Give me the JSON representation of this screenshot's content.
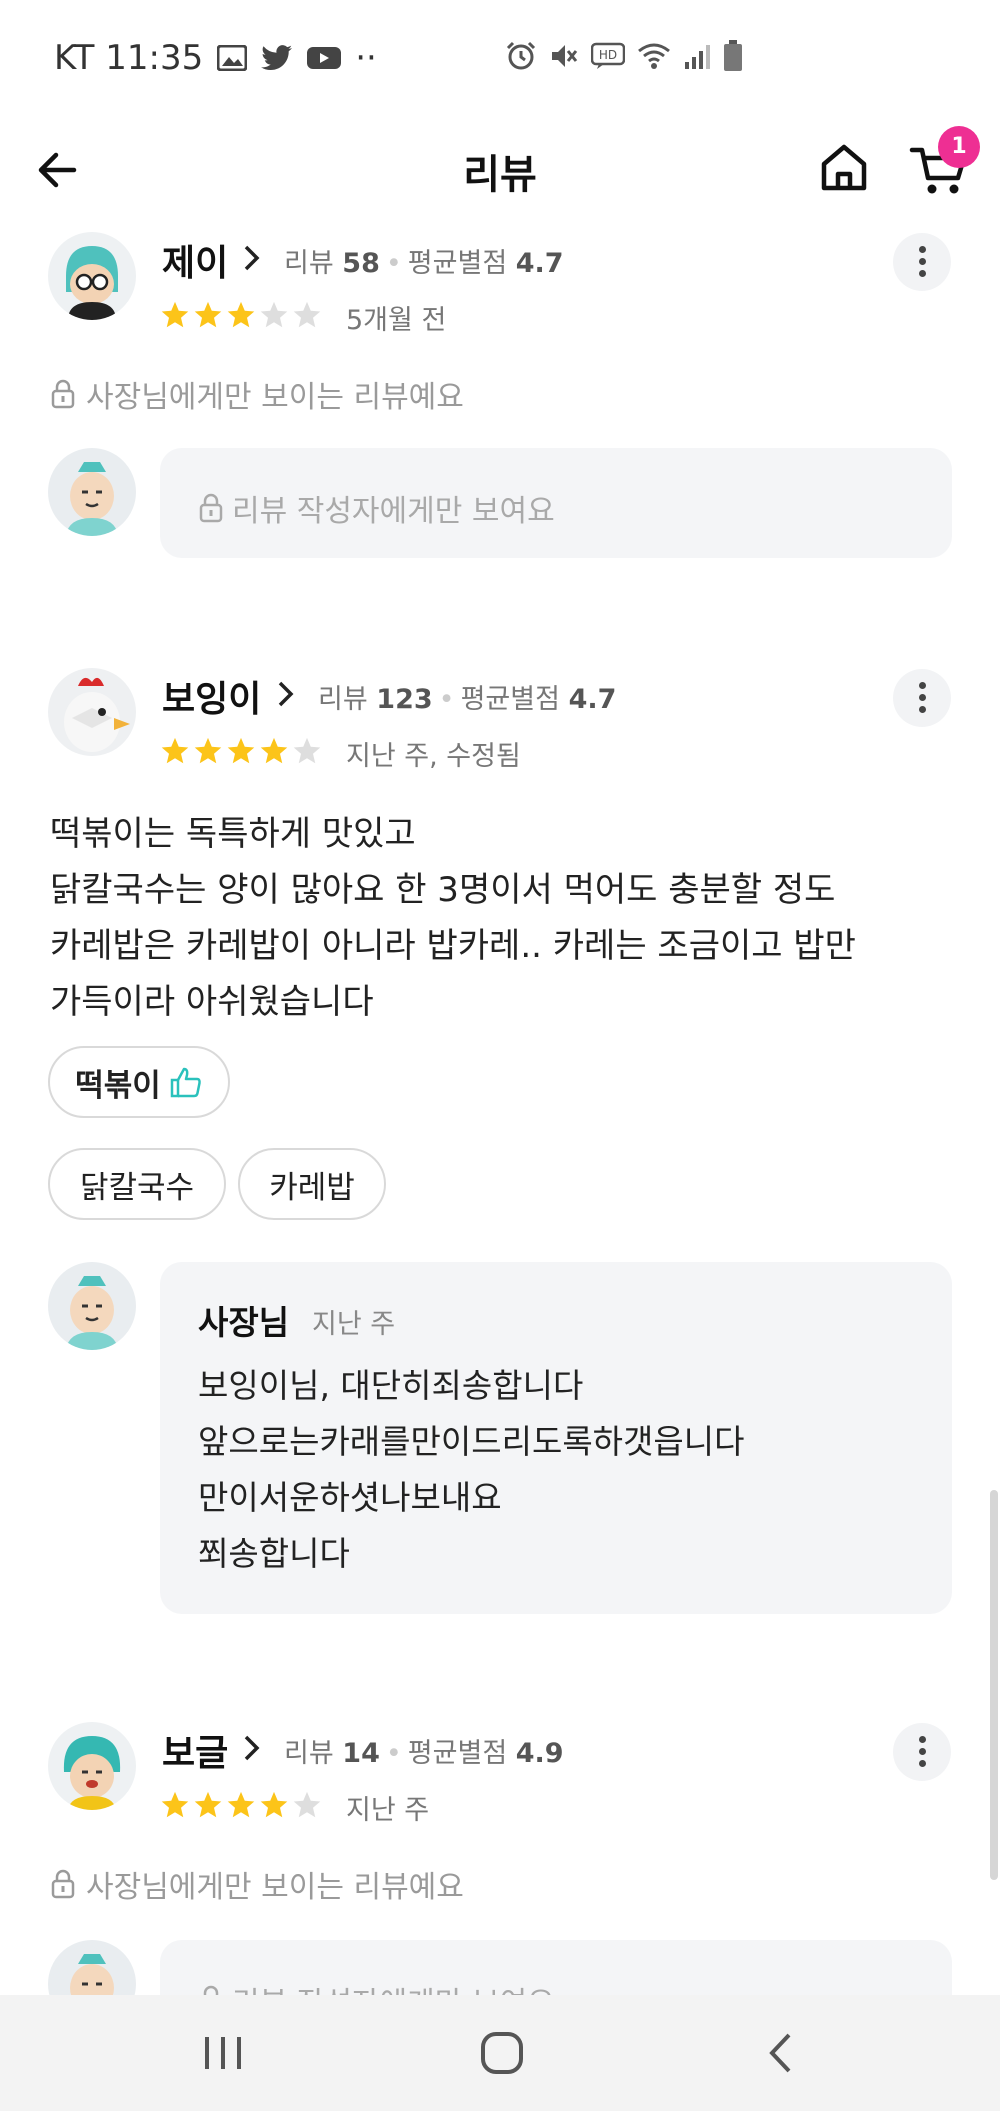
{
  "status": {
    "carrier_time": "KT 11:35",
    "more": "··"
  },
  "header": {
    "title": "리뷰",
    "cart_count": "1"
  },
  "reviews": [
    {
      "name": "제이",
      "review_label": "리뷰",
      "review_count": "58",
      "avg_label": "평균별점",
      "avg": "4.7",
      "stars": 3,
      "date": "5개월 전",
      "private_note": "사장님에게만 보이는 리뷰예요",
      "reply_private": "리뷰 작성자에게만 보여요"
    },
    {
      "name": "보잉이",
      "review_label": "리뷰",
      "review_count": "123",
      "avg_label": "평균별점",
      "avg": "4.7",
      "stars": 4,
      "date": "지난 주, 수정됨",
      "text": "떡볶이는 독특하게 맛있고\n닭칼국수는 양이 많아요 한 3명이서 먹어도 충분할 정도\n카레밥은 카레밥이 아니라 밥카레.. 카레는 조금이고 밥만\n가득이라 아쉬웠습니다",
      "menu_tags": [
        {
          "label": "떡볶이",
          "liked": true
        },
        {
          "label": "닭칼국수",
          "liked": false
        },
        {
          "label": "카레밥",
          "liked": false
        }
      ],
      "owner_reply": {
        "name": "사장님",
        "date": "지난 주",
        "text": "보잉이님, 대단히죄송합니다\n앞으로는카래를만이드리도록하갯읍니다\n만이서운하셧나보내요\n쬐송합니다"
      }
    },
    {
      "name": "보글",
      "review_label": "리뷰",
      "review_count": "14",
      "avg_label": "평균별점",
      "avg": "4.9",
      "stars": 4,
      "date": "지난 주",
      "private_note": "사장님에게만 보이는 리뷰예요",
      "reply_private": "리뷰 작성자에게만 보여요"
    }
  ],
  "colors": {
    "star": "#fcc419",
    "star_empty": "#dedede",
    "badge": "#ee2f93",
    "like": "#2ac1bc",
    "bubble": "#f4f5f7"
  }
}
